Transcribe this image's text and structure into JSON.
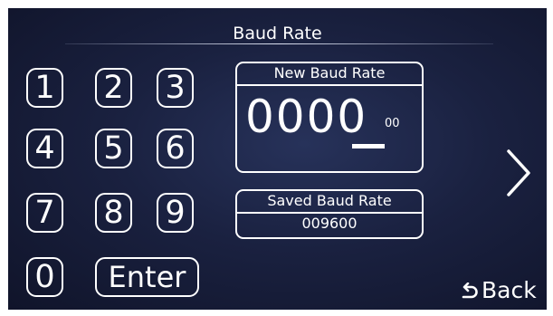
{
  "header": {
    "title": "Baud Rate"
  },
  "keypad": {
    "keys": [
      "1",
      "2",
      "3",
      "4",
      "5",
      "6",
      "7",
      "8",
      "9",
      "0"
    ],
    "enter_label": "Enter"
  },
  "new_rate": {
    "label": "New Baud Rate",
    "value": "0000",
    "fraction": "00"
  },
  "saved_rate": {
    "label": "Saved Baud Rate",
    "value": "009600"
  },
  "nav": {
    "back_label": "Back",
    "next_icon": "chevron-right-icon",
    "back_icon": "undo-arrow-icon"
  },
  "colors": {
    "foreground": "#ffffff",
    "background": "#1a2140"
  }
}
